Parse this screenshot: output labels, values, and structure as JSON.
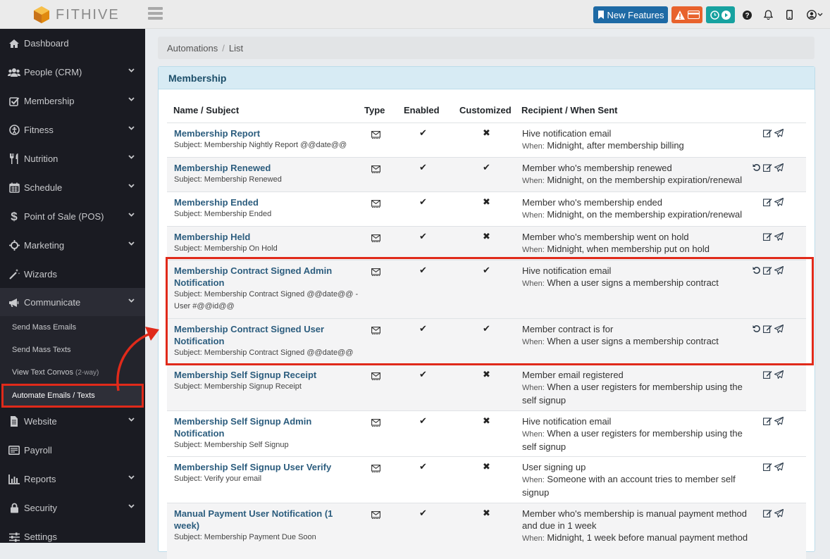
{
  "brand": {
    "name": "FITHIVE"
  },
  "topbar": {
    "new_features_label": "New Features",
    "icons": [
      "bookmark-icon",
      "warning-icon",
      "card-icon",
      "clock-icon",
      "play-icon",
      "help-icon",
      "bell-icon",
      "mobile-icon",
      "user-icon"
    ]
  },
  "sidebar": {
    "items": [
      {
        "label": "Dashboard",
        "icon": "home-icon",
        "chevron": false
      },
      {
        "label": "People (CRM)",
        "icon": "people-icon",
        "chevron": true
      },
      {
        "label": "Membership",
        "icon": "check-square-icon",
        "chevron": true
      },
      {
        "label": "Fitness",
        "icon": "fitness-icon",
        "chevron": false
      },
      {
        "label": "Nutrition",
        "icon": "utensils-icon",
        "chevron": true
      },
      {
        "label": "Schedule",
        "icon": "calendar-icon",
        "chevron": true
      },
      {
        "label": "Point of Sale (POS)",
        "icon": "dollar-icon",
        "chevron": true
      },
      {
        "label": "Marketing",
        "icon": "crosshair-icon",
        "chevron": true
      },
      {
        "label": "Wizards",
        "icon": "magic-wand-icon",
        "chevron": false
      },
      {
        "label": "Communicate",
        "icon": "megaphone-icon",
        "chevron": true
      },
      {
        "label": "Website",
        "icon": "file-icon",
        "chevron": true
      },
      {
        "label": "Payroll",
        "icon": "payroll-icon",
        "chevron": false
      },
      {
        "label": "Reports",
        "icon": "bar-chart-icon",
        "chevron": true
      },
      {
        "label": "Security",
        "icon": "lock-icon",
        "chevron": true
      },
      {
        "label": "Settings",
        "icon": "sliders-icon",
        "chevron": false
      }
    ],
    "communicate_sub": [
      {
        "label": "Send Mass Emails",
        "note": ""
      },
      {
        "label": "Send Mass Texts",
        "note": ""
      },
      {
        "label": "View Text Convos",
        "note": "(2-way)"
      },
      {
        "label": "Automate Emails / Texts",
        "note": ""
      }
    ]
  },
  "breadcrumb": {
    "parent": "Automations",
    "separator": "/",
    "current": "List"
  },
  "card": {
    "title": "Membership"
  },
  "table": {
    "headers": {
      "name": "Name / Subject",
      "type": "Type",
      "enabled": "Enabled",
      "customized": "Customized",
      "recipient": "Recipient / When Sent"
    },
    "when_label": "When:",
    "rows": [
      {
        "name": "Membership Report",
        "subject": "Subject: Membership Nightly Report @@date@@",
        "enabled": true,
        "customized": false,
        "recipient": "Hive notification email",
        "when": "Midnight, after membership billing",
        "reset": false
      },
      {
        "name": "Membership Renewed",
        "subject": "Subject: Membership Renewed",
        "enabled": true,
        "customized": true,
        "recipient": "Member who's membership renewed",
        "when": "Midnight, on the membership expiration/renewal",
        "reset": true
      },
      {
        "name": "Membership Ended",
        "subject": "Subject: Membership Ended",
        "enabled": true,
        "customized": false,
        "recipient": "Member who's membership ended",
        "when": "Midnight, on the membership expiration/renewal",
        "reset": false
      },
      {
        "name": "Membership Held",
        "subject": "Subject: Membership On Hold",
        "enabled": true,
        "customized": false,
        "recipient": "Member who's membership went on hold",
        "when": "Midnight, when membership put on hold",
        "reset": false
      },
      {
        "name": "Membership Contract Signed Admin Notification",
        "subject": "Subject: Membership Contract Signed @@date@@ - User #@@id@@",
        "enabled": true,
        "customized": true,
        "recipient": "Hive notification email",
        "when": "When a user signs a membership contract",
        "reset": true
      },
      {
        "name": "Membership Contract Signed User Notification",
        "subject": "Subject: Membership Contract Signed @@date@@",
        "enabled": true,
        "customized": true,
        "recipient": "Member contract is for",
        "when": "When a user signs a membership contract",
        "reset": true
      },
      {
        "name": "Membership Self Signup Receipt",
        "subject": "Subject: Membership Signup Receipt",
        "enabled": true,
        "customized": false,
        "recipient": "Member email registered",
        "when": "When a user registers for membership using the self signup",
        "reset": false
      },
      {
        "name": "Membership Self Signup Admin Notification",
        "subject": "Subject: Membership Self Signup",
        "enabled": true,
        "customized": false,
        "recipient": "Hive notification email",
        "when": "When a user registers for membership using the self signup",
        "reset": false
      },
      {
        "name": "Membership Self Signup User Verify",
        "subject": "Subject: Verify your email",
        "enabled": true,
        "customized": false,
        "recipient": "User signing up",
        "when": "Someone with an account tries to member self signup",
        "reset": false
      },
      {
        "name": "Manual Payment User Notification (1 week)",
        "subject": "Subject: Membership Payment Due Soon",
        "enabled": true,
        "customized": false,
        "recipient": "Member who's membership is manual payment method and due in 1 week",
        "when": "Midnight, 1 week before manual payment method",
        "reset": false
      }
    ]
  },
  "colors": {
    "highlight": "#e02a1a",
    "sidebar_bg": "#1a1b22",
    "link": "#2c5d7e"
  }
}
